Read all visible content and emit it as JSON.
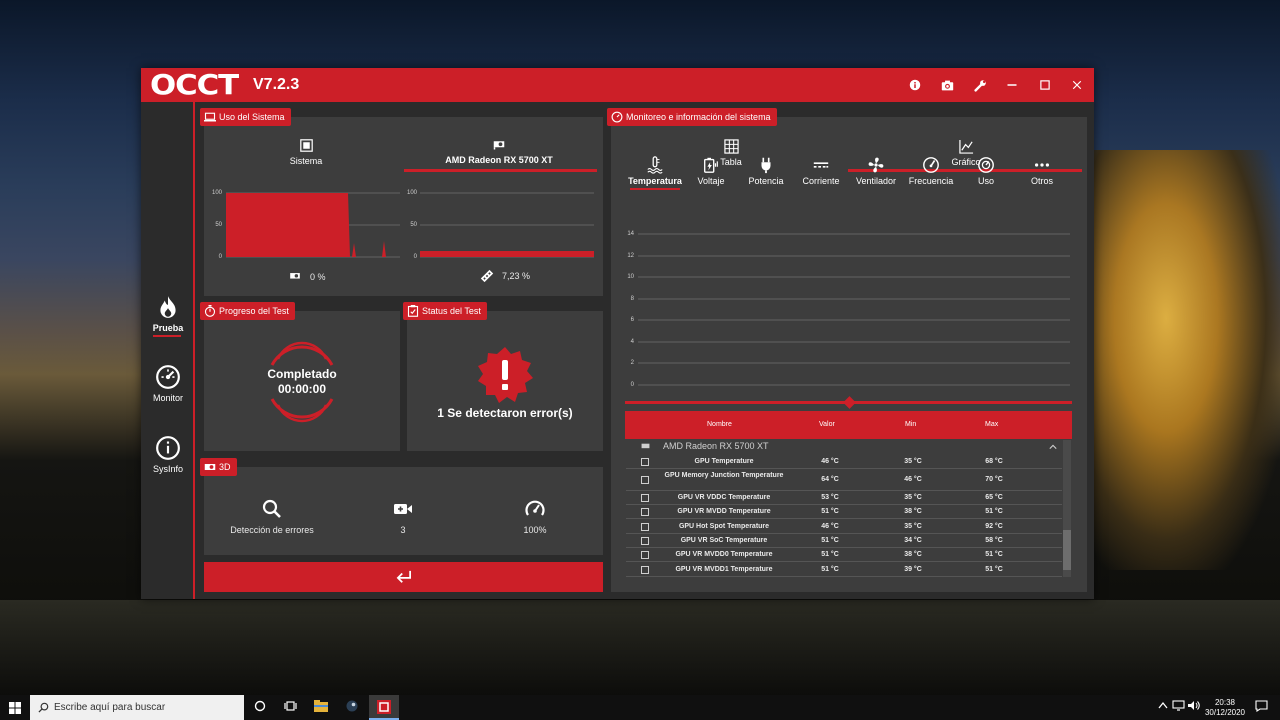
{
  "app": {
    "logo": "OCCT",
    "version": "V7.2.3"
  },
  "titlebar_icons": [
    "info-icon",
    "camera-icon",
    "wrench-icon",
    "minimize-icon",
    "maximize-icon",
    "close-icon"
  ],
  "sidebar": {
    "items": [
      {
        "label": "Prueba",
        "icon": "flame-icon",
        "active": true
      },
      {
        "label": "Monitor",
        "icon": "gauge-icon",
        "active": false
      },
      {
        "label": "SysInfo",
        "icon": "info-circle-icon",
        "active": false
      }
    ]
  },
  "system_usage": {
    "title": "Uso del Sistema",
    "tabs": [
      {
        "label": "Sistema"
      },
      {
        "label": "AMD Radeon RX 5700 XT",
        "active": true
      }
    ],
    "y_ticks": [
      "100",
      "50",
      "0"
    ],
    "cpu_percent": "0 %",
    "gpu_percent": "7,23 %"
  },
  "progress": {
    "title": "Progreso del Test",
    "status": "Completado",
    "time": "00:00:00"
  },
  "status": {
    "title": "Status del Test",
    "message": "1 Se detectaron error(s)"
  },
  "test3d": {
    "title": "3D",
    "items": [
      {
        "label": "Detección de errores",
        "icon": "search-icon"
      },
      {
        "label": "3",
        "icon": "video-camera-icon"
      },
      {
        "label": "100%",
        "icon": "speedometer-icon"
      }
    ]
  },
  "monitor": {
    "title": "Monitoreo e información del sistema",
    "views": [
      {
        "label": "Tabla"
      },
      {
        "label": "Gráfico",
        "active": true
      }
    ],
    "categories": [
      "Temperatura",
      "Voltaje",
      "Potencia",
      "Corriente",
      "Ventilador",
      "Frecuencia",
      "Uso",
      "Otros"
    ],
    "y_ticks": [
      "14",
      "12",
      "10",
      "8",
      "6",
      "4",
      "2",
      "0"
    ],
    "table": {
      "columns": [
        "Nombre",
        "Valor",
        "Min",
        "Max"
      ],
      "device": "AMD Radeon RX 5700 XT",
      "rows": [
        {
          "name": "GPU Temperature",
          "value": "46 °C",
          "min": "35 °C",
          "max": "68 °C"
        },
        {
          "name": "GPU Memory Junction Temperature",
          "value": "64 °C",
          "min": "46 °C",
          "max": "70 °C"
        },
        {
          "name": "GPU VR VDDC Temperature",
          "value": "53 °C",
          "min": "35 °C",
          "max": "65 °C"
        },
        {
          "name": "GPU VR MVDD Temperature",
          "value": "51 °C",
          "min": "38 °C",
          "max": "51 °C"
        },
        {
          "name": "GPU Hot Spot Temperature",
          "value": "46 °C",
          "min": "35 °C",
          "max": "92 °C"
        },
        {
          "name": "GPU VR SoC Temperature",
          "value": "51 °C",
          "min": "34 °C",
          "max": "58 °C"
        },
        {
          "name": "GPU VR MVDD0 Temperature",
          "value": "51 °C",
          "min": "38 °C",
          "max": "51 °C"
        },
        {
          "name": "GPU VR MVDD1 Temperature",
          "value": "51 °C",
          "min": "39 °C",
          "max": "51 °C"
        }
      ]
    }
  },
  "taskbar": {
    "search_placeholder": "Escribe aquí para buscar",
    "time": "20:38",
    "date": "30/12/2020"
  },
  "colors": {
    "accent": "#cc1f28",
    "panel": "#3d3d3d",
    "window": "#2b2b2b"
  }
}
